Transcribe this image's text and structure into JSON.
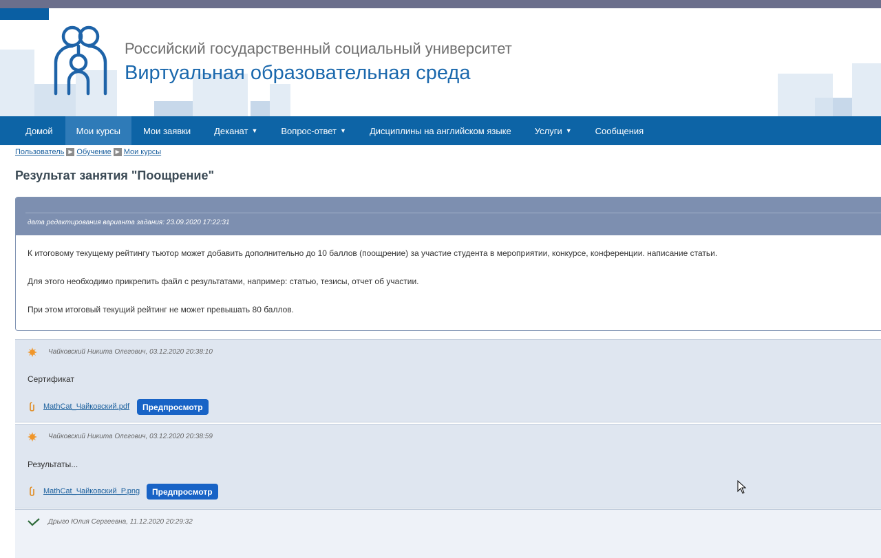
{
  "header": {
    "university": "Российский государственный социальный университет",
    "environment": "Виртуальная образовательная среда"
  },
  "nav": {
    "items": [
      {
        "label": "Домой",
        "has_caret": false,
        "active": false
      },
      {
        "label": "Мои курсы",
        "has_caret": false,
        "active": true
      },
      {
        "label": "Мои заявки",
        "has_caret": false,
        "active": false
      },
      {
        "label": "Деканат",
        "has_caret": true,
        "active": false
      },
      {
        "label": "Вопрос-ответ",
        "has_caret": true,
        "active": false
      },
      {
        "label": "Дисциплины на английском языке",
        "has_caret": false,
        "active": false
      },
      {
        "label": "Услуги",
        "has_caret": true,
        "active": false
      },
      {
        "label": "Сообщения",
        "has_caret": false,
        "active": false
      }
    ]
  },
  "breadcrumb": [
    "Пользователь",
    "Обучение",
    "Мои курсы"
  ],
  "page_title": "Результат занятия \"Поощрение\"",
  "task": {
    "edit_date": "дата редактирования варианта задания: 23.09.2020 17:22:31",
    "paragraphs": [
      "К итоговому текущему рейтингу тьютор может добавить дополнительно до 10 баллов (поощрение) за участие студента в мероприятии, конкурсе, конференции. написание статьи.",
      "Для этого необходимо прикрепить файл с результатами, например: статью, тезисы, отчет об участии.",
      "При этом итоговый текущий рейтинг не может превышать 80 баллов."
    ]
  },
  "comments": [
    {
      "icon": "sun-icon",
      "meta": "Чайковский Никита Олегович, 03.12.2020 20:38:10",
      "text": "Сертификат",
      "file": "MathCat_Чайковский.pdf",
      "preview": "Предпросмотр"
    },
    {
      "icon": "sun-icon",
      "meta": "Чайковский Никита Олегович, 03.12.2020 20:38:59",
      "text": "Результаты...",
      "file": "MathCat_Чайковский_P.png",
      "preview": "Предпросмотр"
    },
    {
      "icon": "check-icon",
      "meta": "Дрыго Юлия Сергеевна, 11.12.2020 20:29:32"
    }
  ],
  "colors": {
    "nav_bg": "#0d64a6",
    "nav_active": "#2f7bb8",
    "brand_blue": "#1a68ad",
    "panel_header": "#7d8fb0",
    "button": "#1863c6",
    "comment_bg": "#dfe6f0",
    "sun_icon": "#f0962a",
    "check_icon": "#2e6b3a"
  }
}
